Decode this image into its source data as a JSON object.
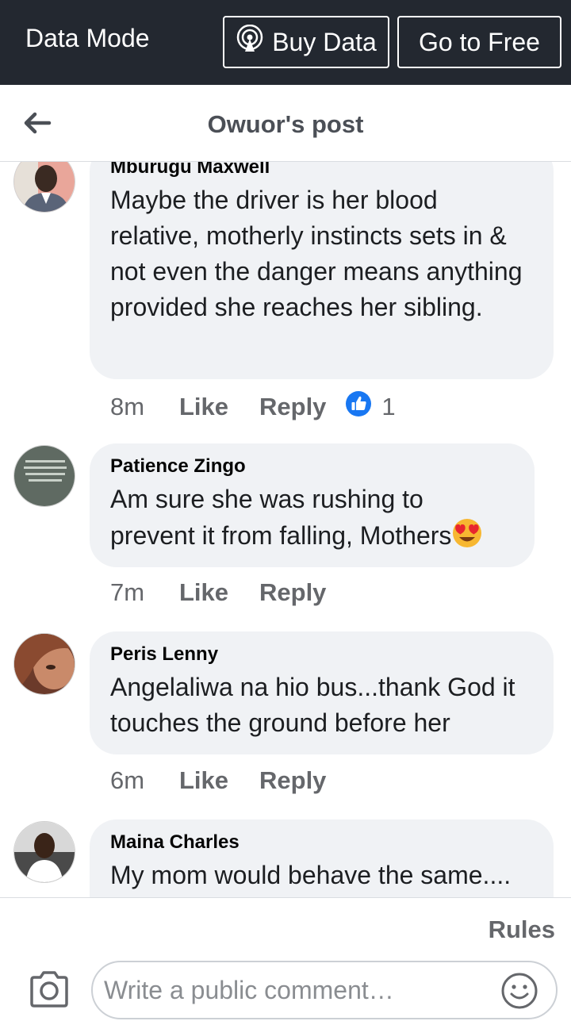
{
  "databar": {
    "mode_label": "Data Mode",
    "buy_label": "Buy Data",
    "free_label": "Go to Free"
  },
  "header": {
    "title": "Owuor's post"
  },
  "comments": [
    {
      "name": "Mburugu Maxwell",
      "text": "Maybe the driver is her blood relative, motherly instincts sets in & not even the danger means anything provided she reaches her sibling.",
      "time": "8m",
      "like": "Like",
      "reply": "Reply",
      "reaction_count": "1"
    },
    {
      "name": "Patience Zingo",
      "text": "Am sure she was rushing to prevent it from falling, Mothers",
      "time": "7m",
      "like": "Like",
      "reply": "Reply"
    },
    {
      "name": "Peris Lenny",
      "text": "Angelaliwa na hio bus...thank God it touches the ground before her",
      "time": "6m",
      "like": "Like",
      "reply": "Reply"
    },
    {
      "name": "Maina Charles",
      "text": "My mom would behave the same...."
    }
  ],
  "composer": {
    "rules_label": "Rules",
    "placeholder": "Write a public comment…"
  },
  "colors": {
    "databar_bg": "#232830",
    "bubble_bg": "#f0f2f5",
    "like_blue": "#1877f2"
  }
}
